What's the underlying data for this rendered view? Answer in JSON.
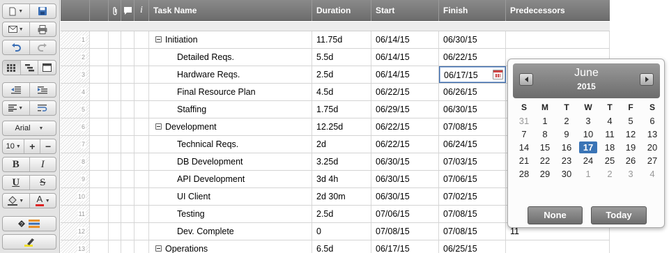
{
  "toolbar": {
    "font_name": "Arial",
    "font_size": "10",
    "bold": "B",
    "italic": "I",
    "underline": "U",
    "strikethrough": "S",
    "font_color": "A"
  },
  "columns": {
    "task_name": "Task Name",
    "duration": "Duration",
    "start": "Start",
    "finish": "Finish",
    "predecessors": "Predecessors",
    "info_icon": "i"
  },
  "rows": [
    {
      "num": "1",
      "name": "Initiation",
      "duration": "11.75d",
      "start": "06/14/15",
      "finish": "06/30/15",
      "parent": true
    },
    {
      "num": "2",
      "name": "Detailed Reqs.",
      "duration": "5.5d",
      "start": "06/14/15",
      "finish": "06/22/15"
    },
    {
      "num": "3",
      "name": "Hardware Reqs.",
      "duration": "2.5d",
      "start": "06/14/15",
      "finish": "06/17/15",
      "editing": true
    },
    {
      "num": "4",
      "name": "Final Resource Plan",
      "duration": "4.5d",
      "start": "06/22/15",
      "finish": "06/26/15"
    },
    {
      "num": "5",
      "name": "Staffing",
      "duration": "1.75d",
      "start": "06/29/15",
      "finish": "06/30/15"
    },
    {
      "num": "6",
      "name": "Development",
      "duration": "12.25d",
      "start": "06/22/15",
      "finish": "07/08/15",
      "parent": true
    },
    {
      "num": "7",
      "name": "Technical Reqs.",
      "duration": "2d",
      "start": "06/22/15",
      "finish": "06/24/15"
    },
    {
      "num": "8",
      "name": "DB Development",
      "duration": "3.25d",
      "start": "06/30/15",
      "finish": "07/03/15"
    },
    {
      "num": "9",
      "name": "API Development",
      "duration": "3d 4h",
      "start": "06/30/15",
      "finish": "07/06/15"
    },
    {
      "num": "10",
      "name": "UI Client",
      "duration": "2d 30m",
      "start": "06/30/15",
      "finish": "07/02/15"
    },
    {
      "num": "11",
      "name": "Testing",
      "duration": "2.5d",
      "start": "07/06/15",
      "finish": "07/08/15"
    },
    {
      "num": "12",
      "name": "Dev. Complete",
      "duration": "0",
      "start": "07/08/15",
      "finish": "07/08/15",
      "predecessors": "11"
    },
    {
      "num": "13",
      "name": "Operations",
      "duration": "6.5d",
      "start": "06/17/15",
      "finish": "06/25/15",
      "parent": true
    }
  ],
  "datepicker": {
    "month": "June",
    "year": "2015",
    "weekdays": [
      "S",
      "M",
      "T",
      "W",
      "T",
      "F",
      "S"
    ],
    "weeks": [
      [
        "31",
        "1",
        "2",
        "3",
        "4",
        "5",
        "6"
      ],
      [
        "7",
        "8",
        "9",
        "10",
        "11",
        "12",
        "13"
      ],
      [
        "14",
        "15",
        "16",
        "17",
        "18",
        "19",
        "20"
      ],
      [
        "21",
        "22",
        "23",
        "24",
        "25",
        "26",
        "27"
      ],
      [
        "28",
        "29",
        "30",
        "1",
        "2",
        "3",
        "4"
      ]
    ],
    "selected_day": "17",
    "none_label": "None",
    "today_label": "Today"
  },
  "colors": {
    "header_bg": "#7b7b7b",
    "selected_day": "#3a74b6",
    "edit_border": "#3c6aa8"
  }
}
